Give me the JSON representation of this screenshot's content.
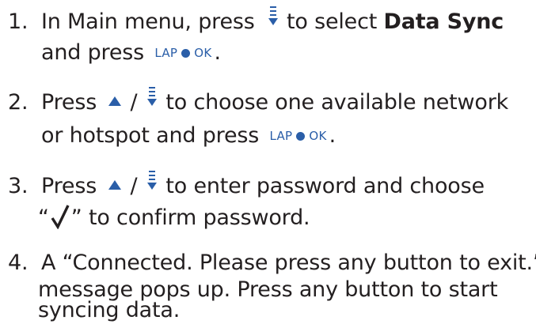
{
  "steps": [
    {
      "num": "1.",
      "a": "In Main  menu, press",
      "b": "to select ",
      "bold": "Data Sync",
      "c": "and press",
      "d": "."
    },
    {
      "num": "2.",
      "a": "Press",
      "sep": "/",
      "b": "to choose one available network",
      "c": "or hotspot and press",
      "d": "."
    },
    {
      "num": "3.",
      "a": "Press",
      "sep": "/",
      "b": "to enter password and choose",
      "c_open": "“",
      "c": "” to confirm password."
    },
    {
      "num": "4.",
      "a": "A “Connected. Please press any button to exit.”",
      "b": "message pops up. Press any button to start",
      "c": "syncing data."
    }
  ],
  "key_label": {
    "left": "LAP",
    "right": "OK"
  },
  "icons": {
    "up": "up-triangle-icon",
    "down": "menu-down-icon",
    "confirm": "check-icon",
    "dot": "dot-icon"
  },
  "colors": {
    "text": "#231f20",
    "key": "#2a5ea8"
  }
}
